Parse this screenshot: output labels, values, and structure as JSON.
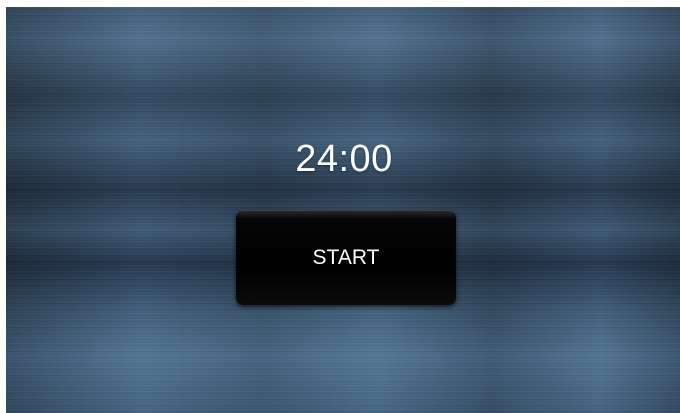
{
  "timer": {
    "value": "24:00"
  },
  "controls": {
    "start_label": "START"
  }
}
